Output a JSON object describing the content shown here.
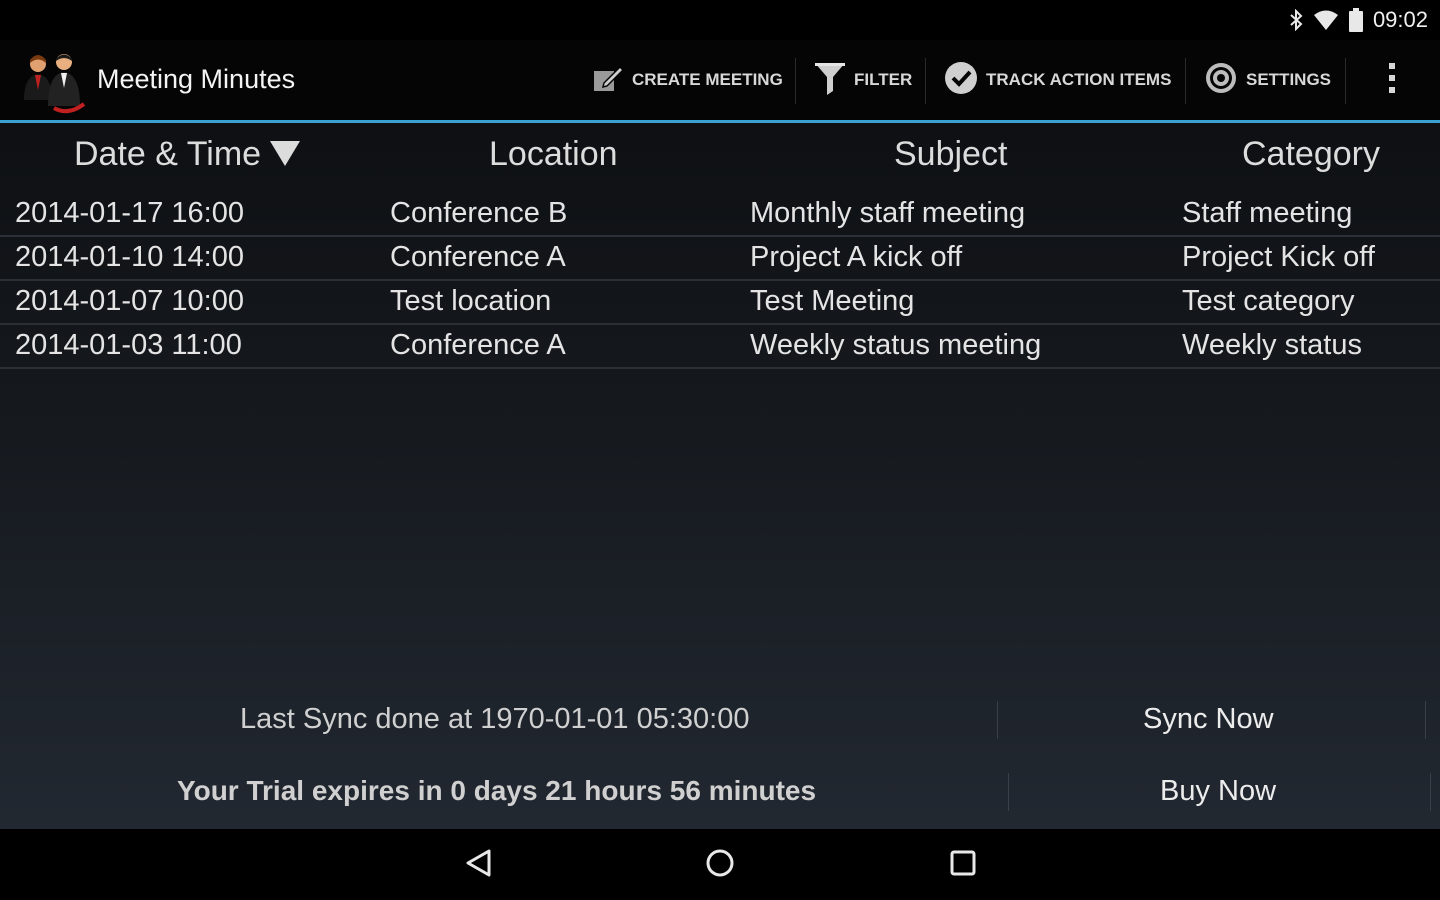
{
  "status_bar": {
    "time": "09:02",
    "icons": [
      "bluetooth-icon",
      "wifi-icon",
      "battery-icon"
    ]
  },
  "app": {
    "title": "Meeting Minutes",
    "accent_color": "#3aa0d0"
  },
  "actions": [
    {
      "label": "CREATE MEETING",
      "icon": "edit-icon"
    },
    {
      "label": "FILTER",
      "icon": "filter-icon"
    },
    {
      "label": "TRACK ACTION ITEMS",
      "icon": "check-circle-icon"
    },
    {
      "label": "SETTINGS",
      "icon": "gear-icon"
    }
  ],
  "table": {
    "columns": [
      "Date & Time",
      "Location",
      "Subject",
      "Category"
    ],
    "rows": [
      [
        "2014-01-17 16:00",
        "Conference B",
        "Monthly staff meeting",
        "Staff meeting"
      ],
      [
        "2014-01-10 14:00",
        "Conference A",
        "Project A kick off",
        "Project Kick off"
      ],
      [
        "2014-01-07 10:00",
        "Test location",
        "Test Meeting",
        "Test category"
      ],
      [
        "2014-01-03 11:00",
        "Conference A",
        "Weekly status meeting",
        "Weekly status"
      ]
    ]
  },
  "footer": {
    "sync_text": "Last Sync done at 1970-01-01 05:30:00",
    "sync_button": "Sync Now",
    "trial_text": "Your Trial expires in 0 days 21 hours 56 minutes",
    "buy_button": "Buy Now"
  },
  "nav": {
    "icons": [
      "back-icon",
      "home-icon",
      "recents-icon"
    ]
  }
}
